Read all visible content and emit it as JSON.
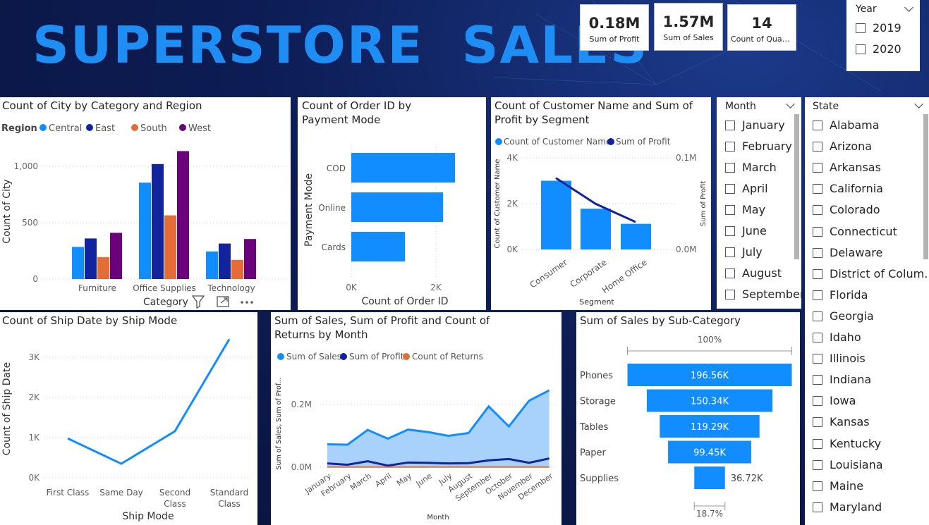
{
  "header": {
    "title": "SUPERSTORE  SALES"
  },
  "cards": [
    {
      "value": "0.18M",
      "label": "Sum of Profit"
    },
    {
      "value": "1.57M",
      "label": "Sum of Sales"
    },
    {
      "value": "14",
      "label": "Count of Quan..."
    }
  ],
  "year_slicer": {
    "title": "Year",
    "options": [
      "2019",
      "2020"
    ]
  },
  "month_slicer": {
    "title": "Month",
    "options": [
      "January",
      "February",
      "March",
      "April",
      "May",
      "June",
      "July",
      "August",
      "September"
    ]
  },
  "state_slicer": {
    "title": "State",
    "options": [
      "Alabama",
      "Arizona",
      "Arkansas",
      "California",
      "Colorado",
      "Connecticut",
      "Delaware",
      "District of Colum...",
      "Florida",
      "Georgia",
      "Idaho",
      "Illinois",
      "Indiana",
      "Iowa",
      "Kansas",
      "Kentucky",
      "Louisiana",
      "Maine",
      "Maryland"
    ]
  },
  "colors": {
    "blue": "#118dff",
    "navy": "#12239e",
    "orange": "#e66c37",
    "purple": "#6b007b",
    "title_blue": "#1e8ef5"
  },
  "chart_data": [
    {
      "type": "bar",
      "title": "Count of City by Category and Region",
      "legend_title": "Region",
      "categories": [
        "Furniture",
        "Office Supplies",
        "Technology"
      ],
      "series": [
        {
          "name": "Central",
          "values": [
            285,
            855,
            245
          ]
        },
        {
          "name": "East",
          "values": [
            360,
            1020,
            315
          ]
        },
        {
          "name": "South",
          "values": [
            195,
            565,
            170
          ]
        },
        {
          "name": "West",
          "values": [
            410,
            1135,
            355
          ]
        }
      ],
      "xlabel": "Category",
      "ylabel": "Count of City",
      "yticks": [
        "0",
        "500",
        "1,000"
      ],
      "ylim": [
        0,
        1200
      ]
    },
    {
      "type": "bar",
      "orientation": "horizontal",
      "title": "Count of Order ID by Payment Mode",
      "categories": [
        "COD",
        "Online",
        "Cards"
      ],
      "values": [
        2450,
        2170,
        1270
      ],
      "xlabel": "Count of Order ID",
      "ylabel": "Payment Mode",
      "xticks": [
        "0K",
        "2K"
      ],
      "xlim": [
        0,
        3000
      ]
    },
    {
      "type": "bar",
      "combo": "line",
      "title": "Count of Customer Name and Sum of Profit by Segment",
      "categories": [
        "Consumer",
        "Corporate",
        "Home Office"
      ],
      "series": [
        {
          "name": "Count of Customer Name",
          "type": "bar",
          "values": [
            3000,
            1780,
            1120
          ]
        },
        {
          "name": "Sum of Profit",
          "type": "line",
          "values": [
            0.078,
            0.05,
            0.03
          ]
        }
      ],
      "xlabel": "Segment",
      "ylabel": "Count of Customer Name",
      "y2label": "Sum of Profit",
      "yticks": [
        "0K",
        "2K",
        "4K"
      ],
      "y2ticks": [
        "0.0M",
        "0.1M"
      ],
      "ylim": [
        0,
        4000
      ],
      "y2lim": [
        0,
        0.1
      ]
    },
    {
      "type": "line",
      "title": "Count of Ship Date by Ship Mode",
      "categories": [
        "First Class",
        "Same Day",
        "Second Class",
        "Standard Class"
      ],
      "values": [
        980,
        350,
        1160,
        3450
      ],
      "xlabel": "Ship Mode",
      "ylabel": "Count of Ship Date",
      "yticks": [
        "0K",
        "1K",
        "2K",
        "3K"
      ],
      "ylim": [
        0,
        3600
      ]
    },
    {
      "type": "area",
      "title": "Sum of Sales, Sum of Profit and Count of Returns by Month",
      "categories": [
        "January",
        "February",
        "March",
        "April",
        "May",
        "June",
        "July",
        "August",
        "September",
        "October",
        "November",
        "December"
      ],
      "series": [
        {
          "name": "Sum of Sales",
          "values": [
            0.073,
            0.072,
            0.119,
            0.091,
            0.12,
            0.112,
            0.1,
            0.109,
            0.194,
            0.13,
            0.212,
            0.245
          ]
        },
        {
          "name": "Sum of Profit",
          "values": [
            0.012,
            0.008,
            0.019,
            0.005,
            0.015,
            0.014,
            0.012,
            0.013,
            0.022,
            0.026,
            0.014,
            0.028
          ]
        },
        {
          "name": "Count of Returns",
          "values": [
            0.0005,
            0.0005,
            0.0005,
            0.0005,
            0.0005,
            0.0005,
            0.0005,
            0.0005,
            0.0005,
            0.0005,
            0.0005,
            0.0005
          ]
        }
      ],
      "xlabel": "Month",
      "ylabel": "Sum of Sales, Sum of Prof...",
      "yticks": [
        "0.0M",
        "0.2M"
      ],
      "ylim": [
        0,
        0.28
      ]
    },
    {
      "type": "bar",
      "subtype": "funnel",
      "title": "Sum of Sales by Sub-Category",
      "categories": [
        "Phones",
        "Storage",
        "Tables",
        "Paper",
        "Supplies"
      ],
      "values": [
        196.56,
        150.34,
        119.29,
        99.45,
        36.72
      ],
      "labels": [
        "196.56K",
        "150.34K",
        "119.29K",
        "99.45K",
        "36.72K"
      ],
      "top_label": "100%",
      "bottom_label": "18.7%"
    }
  ]
}
